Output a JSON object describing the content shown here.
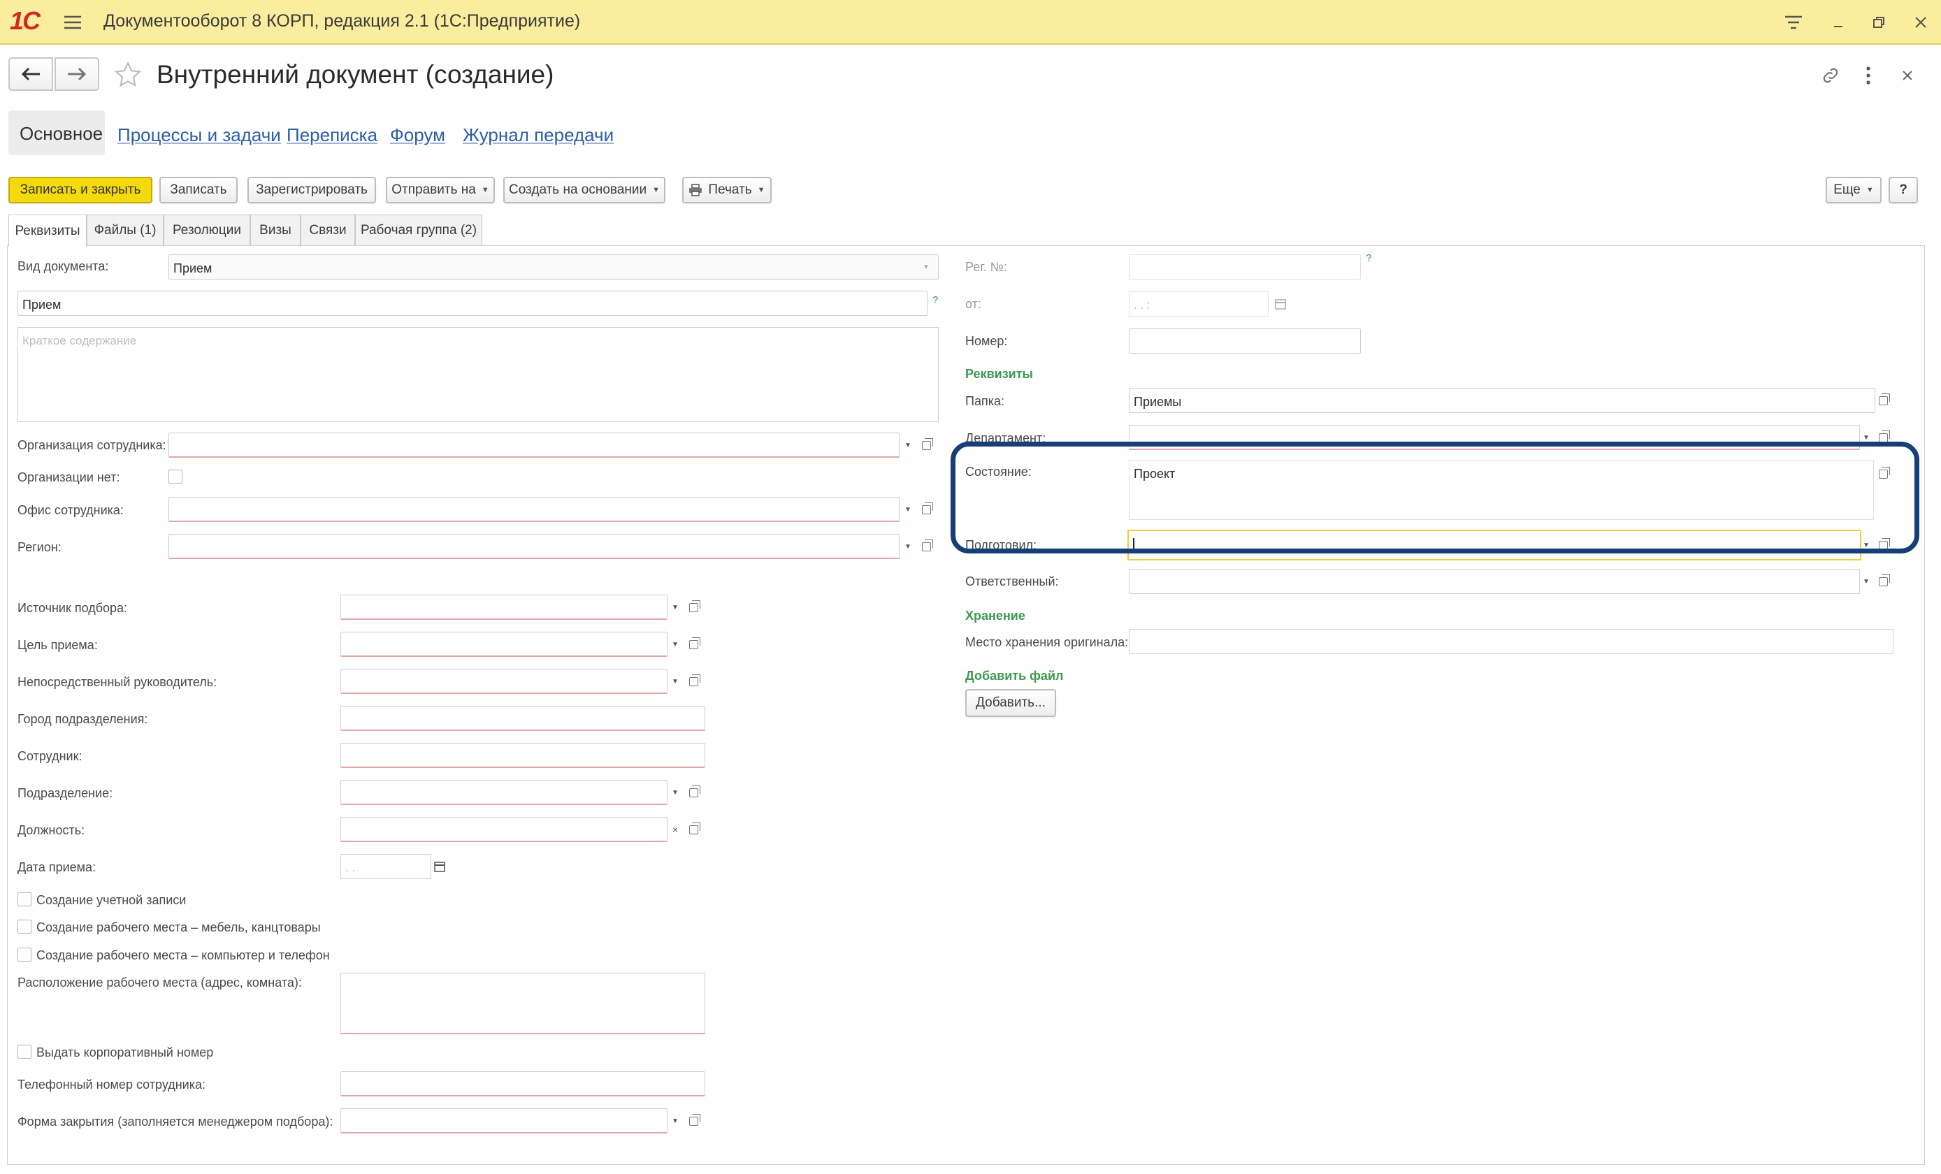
{
  "window": {
    "logo": "1С",
    "title": "Документооборот 8 КОРП, редакция 2.1  (1С:Предприятие)"
  },
  "form": {
    "title": "Внутренний документ (создание)"
  },
  "nav": {
    "main": "Основное",
    "links": [
      "Процессы и задачи",
      "Переписка",
      "Форум",
      "Журнал передачи"
    ]
  },
  "toolbar": {
    "save_close": "Записать и закрыть",
    "save": "Записать",
    "register": "Зарегистрировать",
    "send": "Отправить на",
    "create_based": "Создать на основании",
    "print": "Печать",
    "more": "Еще",
    "help": "?"
  },
  "tabs": [
    "Реквизиты",
    "Файлы (1)",
    "Резолюции",
    "Визы",
    "Связи",
    "Рабочая группа (2)"
  ],
  "left": {
    "doc_type_label": "Вид документа:",
    "doc_type_value": "Прием",
    "name_value": "Прием",
    "summary_placeholder": "Краткое содержание",
    "org_label": "Организация сотрудника:",
    "no_org_label": "Организации нет:",
    "office_label": "Офис сотрудника:",
    "region_label": "Регион:",
    "source_label": "Источник подбора:",
    "goal_label": "Цель приема:",
    "manager_label": "Непосредственный руководитель:",
    "city_label": "Город подразделения:",
    "employee_label": "Сотрудник:",
    "dept_label": "Подразделение:",
    "position_label": "Должность:",
    "hire_date_label": "Дата приема:",
    "hire_date_placeholder": ". .",
    "cb_account": "Создание учетной записи",
    "cb_furniture": "Создание рабочего места – мебель, канцтовары",
    "cb_computer": "Создание рабочего места – компьютер и телефон",
    "workplace_label": "Расположение рабочего места (адрес, комната):",
    "cb_corp_number": "Выдать корпоративный номер",
    "phone_label": "Телефонный номер сотрудника:",
    "closing_form_label": "Форма закрытия (заполняется менеджером подбора):"
  },
  "right": {
    "reg_no_label": "Рег. №:",
    "from_label": "от:",
    "from_placeholder": ". .     :",
    "number_label": "Номер:",
    "section_requisites": "Реквизиты",
    "folder_label": "Папка:",
    "folder_value": "Приемы",
    "department_label": "Департамент:",
    "state_label": "Состояние:",
    "state_value": "Проект",
    "prepared_label": "Подготовил:",
    "responsible_label": "Ответственный:",
    "section_storage": "Хранение",
    "storage_label": "Место хранения оригинала:",
    "section_add_file": "Добавить файл",
    "add_button": "Добавить..."
  },
  "colors": {
    "titlebar": "#fbed9e",
    "primary_button": "#f5d90f",
    "link": "#2c5ea8",
    "section": "#3c9a52",
    "highlight": "#163f7a",
    "required_underline": "#e4a6a6"
  },
  "icons": [
    "1c-logo",
    "menu-icon",
    "filter-icon",
    "minimize-icon",
    "restore-icon",
    "close-icon",
    "back-arrow-icon",
    "forward-arrow-icon",
    "star-icon",
    "link-icon",
    "more-vertical-icon",
    "printer-icon",
    "calendar-icon",
    "open-icon",
    "dropdown-icon",
    "clear-icon"
  ]
}
